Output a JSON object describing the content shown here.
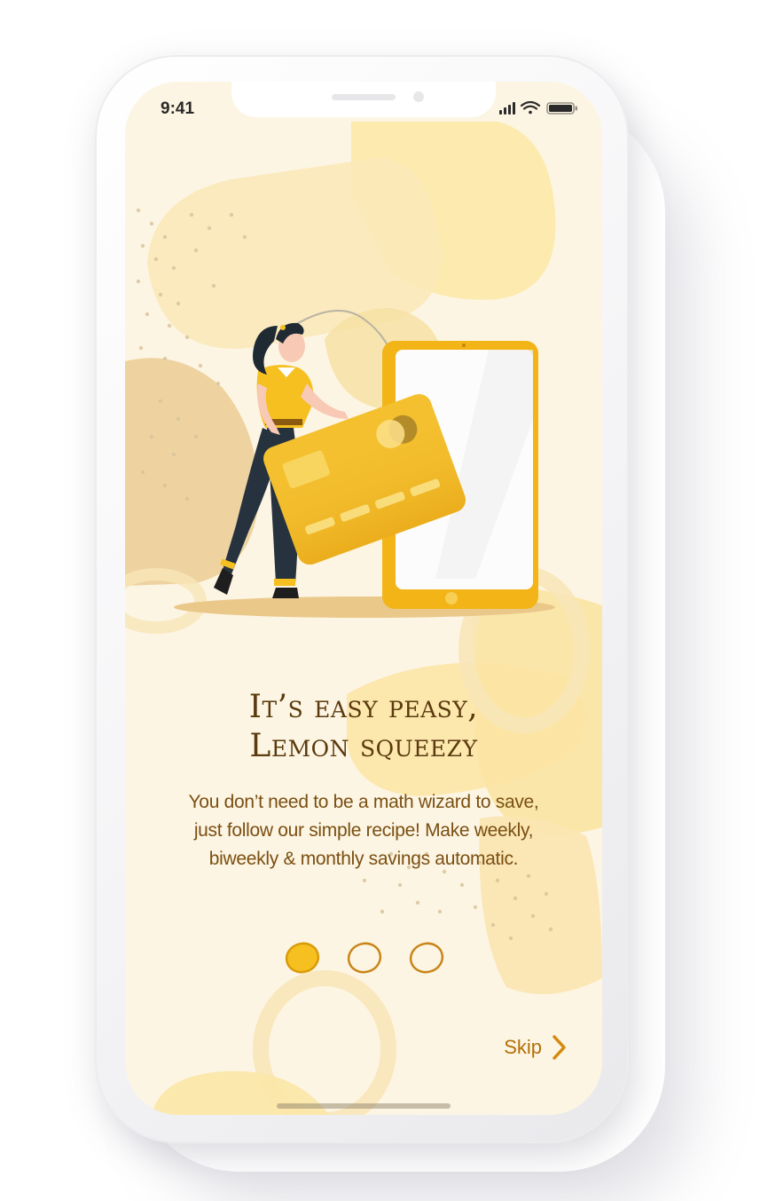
{
  "status_bar": {
    "time": "9:41",
    "icons": [
      "signal-icon",
      "wifi-icon",
      "battery-icon"
    ]
  },
  "onboarding": {
    "headline_line1": "It’s easy peasy,",
    "headline_line2": "Lemon squeezy",
    "description_line1": "You don’t need to be a math wizard to save,",
    "description_line2": "just follow our simple recipe! Make weekly,",
    "description_line3": "biweekly & monthly savings automatic.",
    "page_indicator": {
      "total": 3,
      "current": 1
    },
    "skip_label": "Skip"
  },
  "colors": {
    "background": "#fdf5e3",
    "accent": "#f5c020",
    "headline": "#5a3a0e",
    "body_text": "#7a4f12",
    "skip": "#b26f08"
  }
}
